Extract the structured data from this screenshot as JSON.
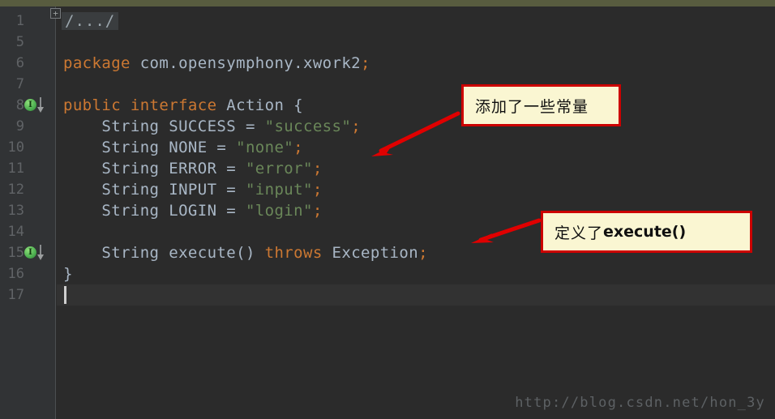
{
  "app": {
    "type": "code-editor",
    "theme": "darcula",
    "background": "#2b2b2b",
    "gutter_background": "#313335",
    "top_strip_color": "#585c3f"
  },
  "gutter": {
    "line_numbers": [
      "1",
      "5",
      "6",
      "7",
      "8",
      "9",
      "10",
      "11",
      "12",
      "13",
      "14",
      "15",
      "16",
      "17"
    ],
    "fold_marker": "+",
    "markers": [
      {
        "line": "8",
        "badge": "I",
        "icon": "interface-marker-icon",
        "arrow": "implemented-by-arrow-icon"
      },
      {
        "line": "15",
        "badge": "I",
        "icon": "interface-marker-icon",
        "arrow": "implemented-by-arrow-icon"
      }
    ]
  },
  "editor": {
    "folded_comment": "/.../",
    "caret_line": "17",
    "lines": [
      {
        "n": "1",
        "tokens": []
      },
      {
        "n": "5",
        "tokens": []
      },
      {
        "n": "6",
        "tokens": [
          {
            "t": "package",
            "c": "kw"
          },
          {
            "t": " com.opensymphony.xwork2",
            "c": "plain"
          },
          {
            "t": ";",
            "c": "pun"
          }
        ]
      },
      {
        "n": "7",
        "tokens": []
      },
      {
        "n": "8",
        "tokens": [
          {
            "t": "public interface",
            "c": "kw"
          },
          {
            "t": " Action {",
            "c": "plain"
          }
        ]
      },
      {
        "n": "9",
        "tokens": [
          {
            "t": "    String SUCCESS = ",
            "c": "plain"
          },
          {
            "t": "\"success\"",
            "c": "str"
          },
          {
            "t": ";",
            "c": "pun"
          }
        ]
      },
      {
        "n": "10",
        "tokens": [
          {
            "t": "    String NONE = ",
            "c": "plain"
          },
          {
            "t": "\"none\"",
            "c": "str"
          },
          {
            "t": ";",
            "c": "pun"
          }
        ]
      },
      {
        "n": "11",
        "tokens": [
          {
            "t": "    String ERROR = ",
            "c": "plain"
          },
          {
            "t": "\"error\"",
            "c": "str"
          },
          {
            "t": ";",
            "c": "pun"
          }
        ]
      },
      {
        "n": "12",
        "tokens": [
          {
            "t": "    String INPUT = ",
            "c": "plain"
          },
          {
            "t": "\"input\"",
            "c": "str"
          },
          {
            "t": ";",
            "c": "pun"
          }
        ]
      },
      {
        "n": "13",
        "tokens": [
          {
            "t": "    String LOGIN = ",
            "c": "plain"
          },
          {
            "t": "\"login\"",
            "c": "str"
          },
          {
            "t": ";",
            "c": "pun"
          }
        ]
      },
      {
        "n": "14",
        "tokens": []
      },
      {
        "n": "15",
        "tokens": [
          {
            "t": "    String execute() ",
            "c": "plain"
          },
          {
            "t": "throws",
            "c": "kw"
          },
          {
            "t": " Exception",
            "c": "plain"
          },
          {
            "t": ";",
            "c": "pun"
          }
        ]
      },
      {
        "n": "16",
        "tokens": [
          {
            "t": "}",
            "c": "plain"
          }
        ]
      },
      {
        "n": "17",
        "tokens": []
      }
    ],
    "colors": {
      "keyword": "#cc7832",
      "identifier": "#a9b7c6",
      "string": "#6a8759",
      "line_number": "#606366"
    }
  },
  "annotations": {
    "box_fill": "#faf6d2",
    "box_border": "#cc0000",
    "arrow_color": "#e00000",
    "callouts": [
      {
        "id": "constants-callout",
        "text_cn": "添加了一些常量",
        "text_latin": ""
      },
      {
        "id": "execute-callout",
        "text_cn": "定义了",
        "text_latin": "execute()"
      }
    ]
  },
  "watermark": {
    "text": "http://blog.csdn.net/hon_3y"
  }
}
